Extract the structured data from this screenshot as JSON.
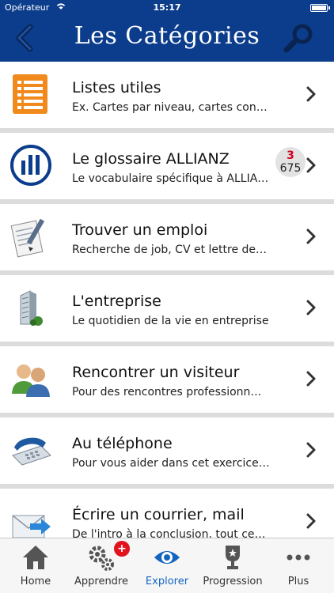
{
  "status_bar": {
    "carrier": "Opérateur",
    "time": "15:17"
  },
  "nav": {
    "title": "Les Catégories",
    "back_icon": "chevron-left-icon",
    "search_icon": "search-icon"
  },
  "colors": {
    "nav_bg": "#0c3d8c",
    "accent_orange": "#f08a1c",
    "badge_red": "#e0131f",
    "active_tab": "#1465c0"
  },
  "categories": [
    {
      "title": "Listes utiles",
      "subtitle": "Ex. Cartes par niveau, cartes con…",
      "icon": "list-icon"
    },
    {
      "title": "Le glossaire ALLIANZ",
      "subtitle": "Le vocabulaire spécifique à ALLIA…",
      "icon": "allianz-logo-icon",
      "counter_top": "3",
      "counter_bottom": "675"
    },
    {
      "title": "Trouver un emploi",
      "subtitle": "Recherche de job, CV et lettre de…",
      "icon": "document-pen-icon"
    },
    {
      "title": "L'entreprise",
      "subtitle": "Le quotidien de la vie en entreprise",
      "icon": "building-icon"
    },
    {
      "title": "Rencontrer un visiteur",
      "subtitle": "Pour des rencontres professionn…",
      "icon": "people-icon"
    },
    {
      "title": "Au téléphone",
      "subtitle": "Pour vous aider dans cet exercice…",
      "icon": "telephone-icon"
    },
    {
      "title": "Écrire un courrier, mail",
      "subtitle": "De l'intro à la conclusion, tout ce…",
      "icon": "mail-icon"
    }
  ],
  "tabs": [
    {
      "label": "Home",
      "icon": "home-icon"
    },
    {
      "label": "Apprendre",
      "icon": "gears-icon",
      "badge": "+"
    },
    {
      "label": "Explorer",
      "icon": "eye-icon",
      "active": true
    },
    {
      "label": "Progression",
      "icon": "trophy-icon"
    },
    {
      "label": "Plus",
      "icon": "more-icon"
    }
  ]
}
